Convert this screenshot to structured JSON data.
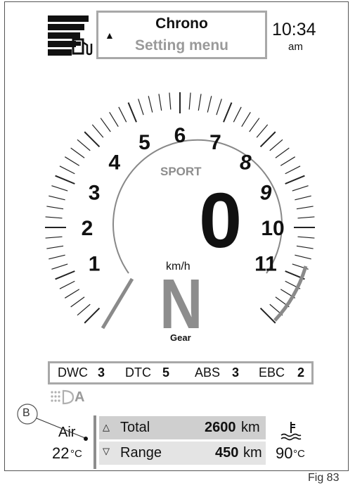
{
  "header": {
    "menu_title": "Chrono",
    "menu_subtitle": "Setting menu",
    "time": "10:34",
    "ampm": "am",
    "up_arrow": "▲"
  },
  "tach": {
    "numbers": [
      "1",
      "2",
      "3",
      "4",
      "5",
      "6",
      "7",
      "8",
      "9",
      "10",
      "11"
    ],
    "mode": "SPORT",
    "speed": "0",
    "speed_unit": "km/h",
    "gear": "N",
    "gear_label": "Gear"
  },
  "status": {
    "items": [
      {
        "label": "DWC",
        "value": "3"
      },
      {
        "label": "DTC",
        "value": "5"
      },
      {
        "label": "ABS",
        "value": "3"
      },
      {
        "label": "EBC",
        "value": "2"
      }
    ]
  },
  "lights": {
    "label": "A"
  },
  "bottom": {
    "air_label": "Air",
    "air_temp": "22",
    "air_unit": "°C",
    "total_label": "Total",
    "total_value": "2600",
    "total_unit": "km",
    "range_label": "Range",
    "range_value": "450",
    "range_unit": "km",
    "coolant_temp": "90",
    "coolant_unit": "°C",
    "up_arrow": "△",
    "down_arrow": "▽"
  },
  "annotation": {
    "callout": "B",
    "fig": "Fig 83"
  },
  "colors": {
    "accent_gray": "#8d8d8d",
    "box_border": "#a8a8a8",
    "row_total": "#cfcfcf",
    "row_range": "#e4e4e4"
  }
}
